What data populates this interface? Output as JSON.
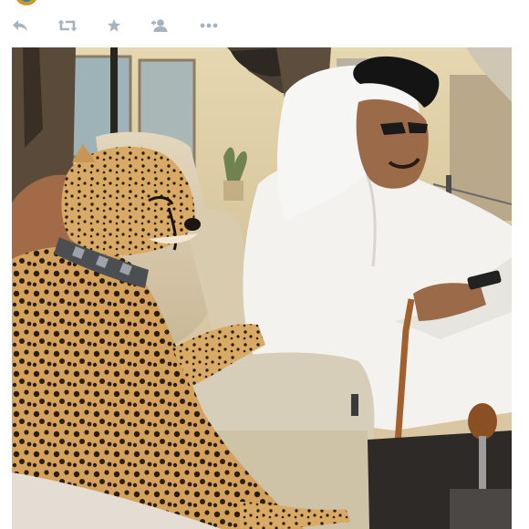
{
  "tweet": {
    "actions": {
      "reply_icon": "reply-icon",
      "retweet_icon": "retweet-icon",
      "favorite_icon": "star-icon",
      "follow_icon": "add-user-icon",
      "more_icon": "more-dots-icon"
    },
    "icon_color": "#a7b3bf",
    "media": {
      "kind": "photo",
      "subject": "cheetah-in-car"
    }
  }
}
